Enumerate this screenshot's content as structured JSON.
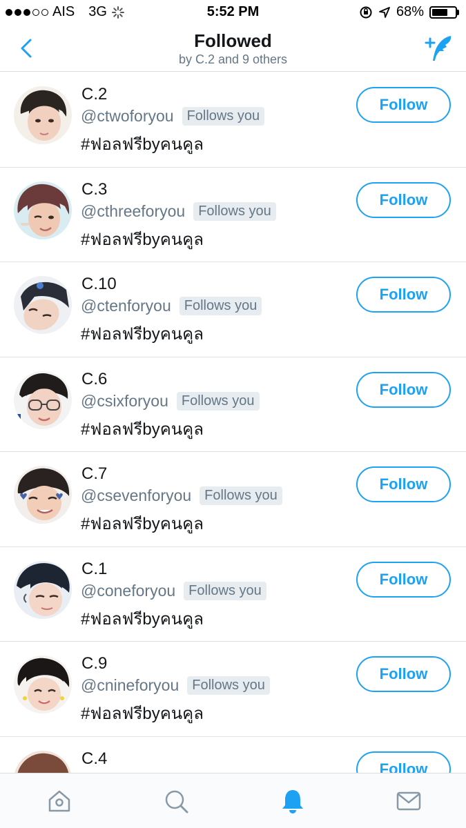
{
  "status_bar": {
    "carrier": "AIS",
    "network": "3G",
    "time": "5:52 PM",
    "battery": "68%",
    "battery_level": 0.68
  },
  "header": {
    "title": "Followed",
    "subtitle": "by C.2 and 9 others",
    "back_icon": "chevron-left-icon",
    "compose_icon": "compose-tweet-icon",
    "accent_color": "#1da1f2"
  },
  "users": [
    {
      "name": "C.2",
      "handle": "@ctwoforyou",
      "follows_you": "Follows you",
      "bio": "#ฟอลฟรีbyคนคูล",
      "follow_label": "Follow"
    },
    {
      "name": "C.3",
      "handle": "@cthreeforyou",
      "follows_you": "Follows you",
      "bio": "#ฟอลฟรีbyคนคูล",
      "follow_label": "Follow"
    },
    {
      "name": "C.10",
      "handle": "@ctenforyou",
      "follows_you": "Follows you",
      "bio": "#ฟอลฟรีbyคนคูล",
      "follow_label": "Follow"
    },
    {
      "name": "C.6",
      "handle": "@csixforyou",
      "follows_you": "Follows you",
      "bio": "#ฟอลฟรีbyคนคูล",
      "follow_label": "Follow"
    },
    {
      "name": "C.7",
      "handle": "@csevenforyou",
      "follows_you": "Follows you",
      "bio": "#ฟอลฟรีbyคนคูล",
      "follow_label": "Follow"
    },
    {
      "name": "C.1",
      "handle": "@coneforyou",
      "follows_you": "Follows you",
      "bio": "#ฟอลฟรีbyคนคูล",
      "follow_label": "Follow"
    },
    {
      "name": "C.9",
      "handle": "@cnineforyou",
      "follows_you": "Follows you",
      "bio": "#ฟอลฟรีbyคนคูล",
      "follow_label": "Follow"
    },
    {
      "name": "C.4",
      "handle": "",
      "follows_you": "",
      "bio": "",
      "follow_label": "Follow"
    }
  ],
  "tab_bar": {
    "tabs": [
      {
        "icon": "home-icon",
        "active": false
      },
      {
        "icon": "search-icon",
        "active": false
      },
      {
        "icon": "notifications-bell-icon",
        "active": true
      },
      {
        "icon": "messages-envelope-icon",
        "active": false
      }
    ]
  }
}
